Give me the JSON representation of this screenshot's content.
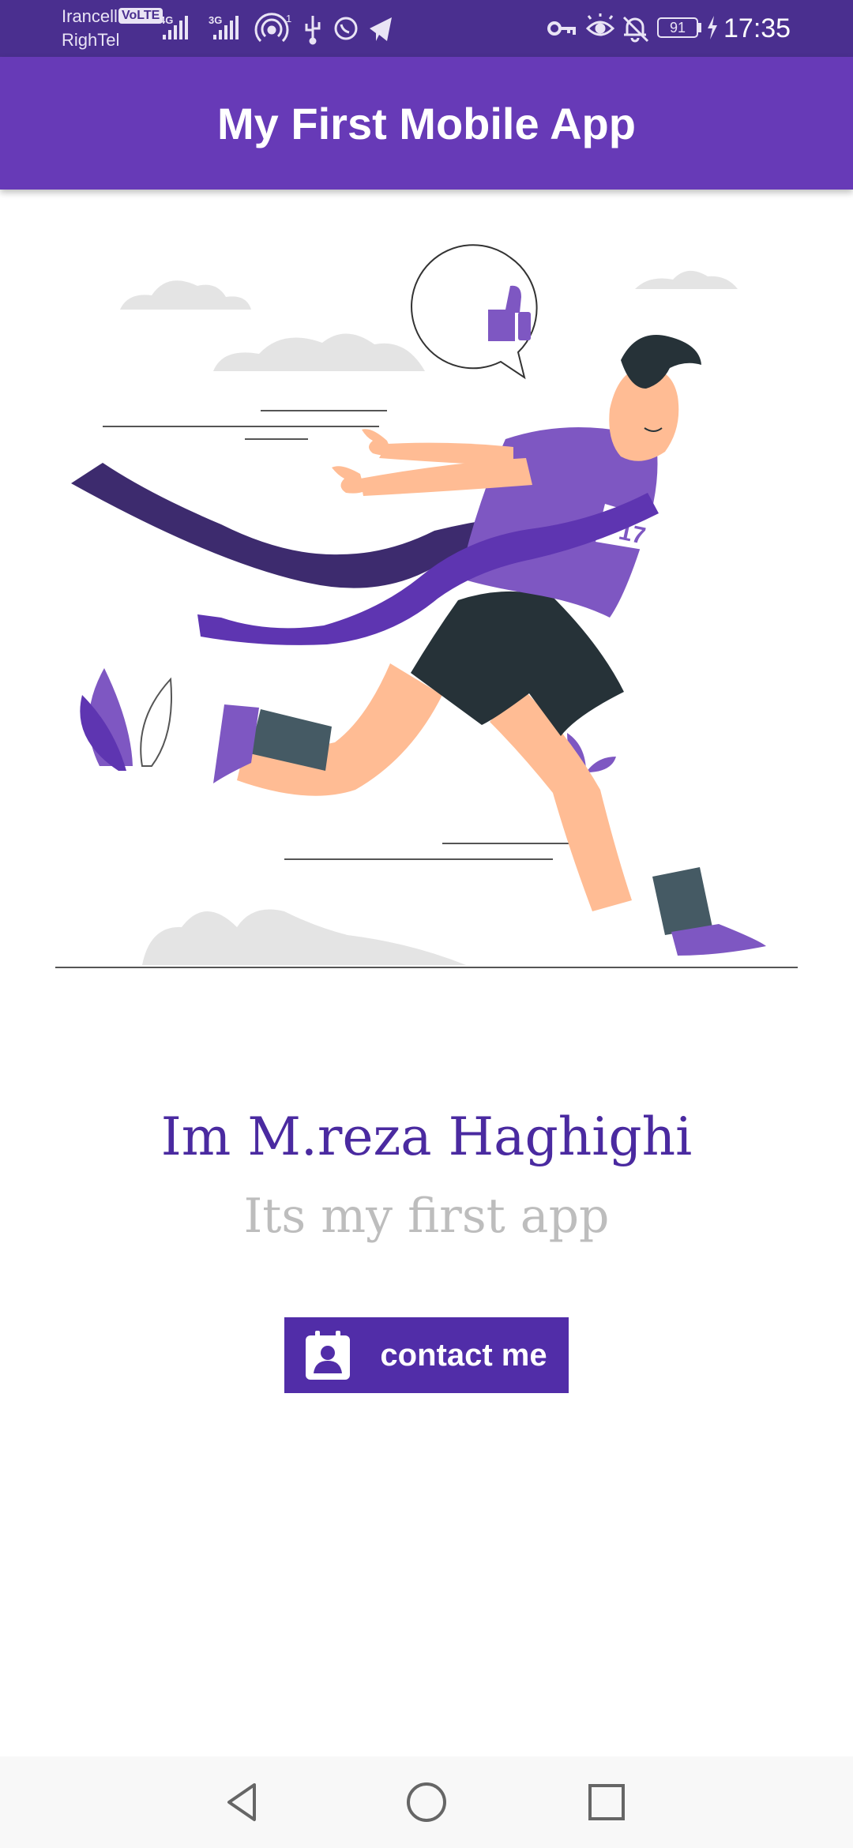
{
  "status_bar": {
    "carrier_1": "Irancell",
    "carrier_2": "RighTel",
    "volte_badge": "VoLTE",
    "network_1": "4G",
    "network_2": "3G",
    "sim_slot": "1",
    "battery_level": "91",
    "time": "17:35",
    "left_icons": [
      "signal-4g-icon",
      "signal-3g-icon",
      "hotspot-icon",
      "usb-icon",
      "whatsapp-icon",
      "telegram-icon"
    ],
    "right_icons": [
      "vpn-key-icon",
      "eye-comfort-icon",
      "notifications-off-icon",
      "battery-icon",
      "charging-icon"
    ]
  },
  "app_bar": {
    "title": "My First Mobile App",
    "color": "#673ab7"
  },
  "hero": {
    "name": "Im M.reza Haghighi",
    "tagline": "Its my first app",
    "illustration": "runner-crossing-finish-line-illustration",
    "bib_number": "17"
  },
  "contact_button": {
    "label": "contact me",
    "icon": "contact-card-icon",
    "color": "#512da8"
  },
  "colors": {
    "name_text": "#4a2aa0",
    "tagline_text": "#bdbdbd",
    "accent_purple": "#7e57c2"
  },
  "nav_bar": {
    "icons": [
      "back-triangle-icon",
      "home-circle-icon",
      "recents-square-icon"
    ]
  }
}
